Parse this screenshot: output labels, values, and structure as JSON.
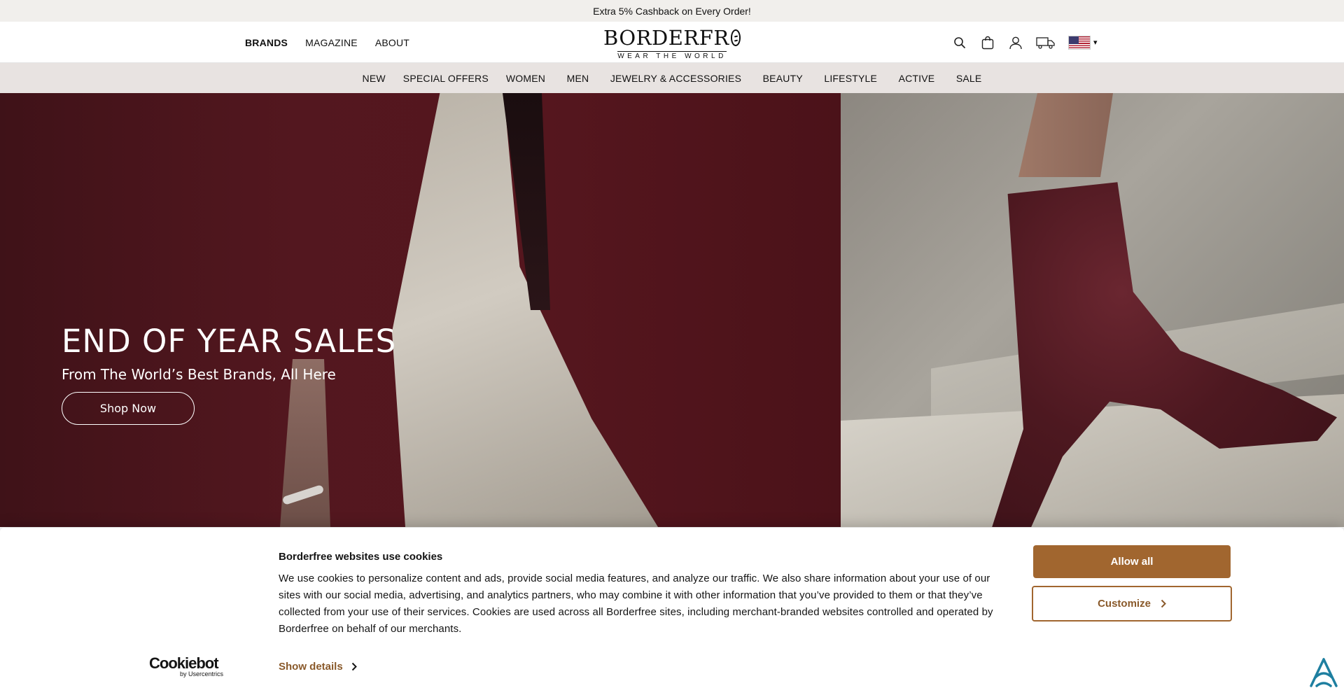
{
  "promo": {
    "text": "Extra 5% Cashback on Every Order!"
  },
  "header": {
    "nav_left": [
      "BRANDS",
      "MAGAZINE",
      "ABOUT"
    ],
    "logo_main": "BORDERFR",
    "logo_sub": "WEAR THE WORLD",
    "country_caret": "▾",
    "icons": [
      "search-icon",
      "bag-icon",
      "user-icon",
      "truck-icon",
      "us-flag-icon"
    ]
  },
  "categories": [
    "NEW",
    "SPECIAL OFFERS",
    "WOMEN",
    "MEN",
    "JEWELRY & ACCESSORIES",
    "BEAUTY",
    "LIFESTYLE",
    "ACTIVE",
    "SALE"
  ],
  "hero": {
    "title": "END OF YEAR SALES",
    "subtitle": "From The World’s Best Brands, All Here",
    "cta": "Shop Now"
  },
  "cookie": {
    "title": "Borderfree websites use cookies",
    "text": "We use cookies to personalize content and ads, provide social media features, and analyze our traffic. We also share information about your use of our sites with our social media, advertising, and analytics partners, who may combine it with other information that you’ve provided to them or that they’ve collected from your use of their services. Cookies are used across all Borderfree sites, including merchant-branded websites controlled and operated by Borderfree on behalf of our merchants.",
    "show_details": "Show details",
    "allow_all": "Allow all",
    "customize": "Customize",
    "cookiebot_brand": "Cookiebot",
    "cookiebot_by": "by Usercentrics"
  },
  "colors": {
    "accent": "#a1662f",
    "hero_bg": "#53171f",
    "nav_bg": "#e8e3e1",
    "promo_bg": "#f1efec"
  }
}
